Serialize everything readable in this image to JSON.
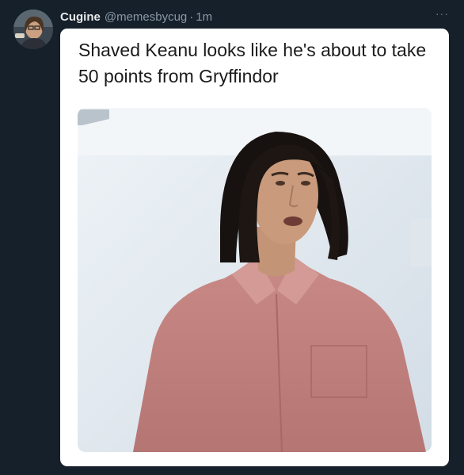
{
  "tweet": {
    "author": {
      "display_name": "Cugine",
      "handle": "@memesbycug",
      "separator": "·",
      "time": "1m",
      "avatar_icon": "user-avatar"
    },
    "more_icon": "more-icon",
    "more_glyph": "···"
  },
  "meme": {
    "caption": "Shaved Keanu looks like he's about to take 50 points from Gryffindor",
    "image_icon": "meme-photo"
  },
  "colors": {
    "background": "#15202b",
    "card": "#ffffff",
    "name": "#e7e9ea",
    "muted": "#8b98a5"
  }
}
